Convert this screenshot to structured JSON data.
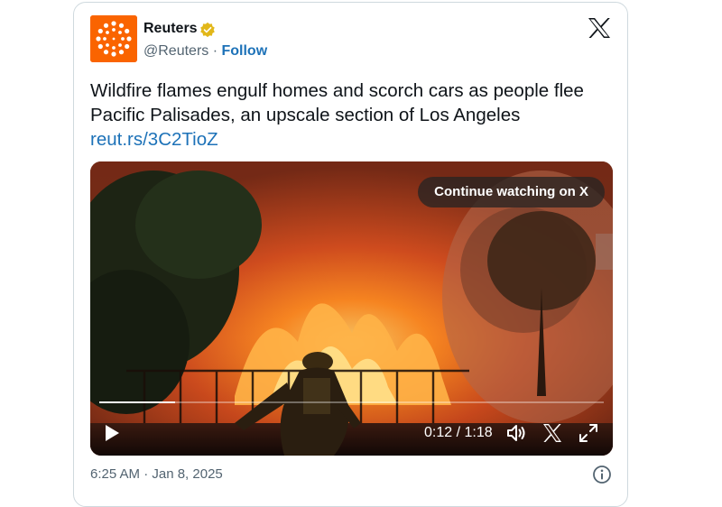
{
  "account": {
    "name": "Reuters",
    "handle_line": "@Reuters · ",
    "follow_label": "Follow",
    "brand_color": "#fa6400",
    "verified_color": "#e2b719",
    "avatar_icon": "reuters-dot-ring-logo"
  },
  "tweet": {
    "text": "Wildfire flames engulf homes and scorch cars as people flee Pacific Palisades, an upscale section of Los Angeles",
    "link": "reut.rs/3C2TioZ",
    "link_color": "#1d72b8"
  },
  "video": {
    "continue_label": "Continue watching on X",
    "time_display": "0:12 / 1:18",
    "progress": 0.15,
    "controls": [
      "play-icon",
      "volume-icon",
      "x-logo-icon",
      "fullscreen-icon"
    ]
  },
  "footer": {
    "timestamp": "6:25 AM · Jan 8, 2025",
    "info_icon": "info-icon"
  }
}
